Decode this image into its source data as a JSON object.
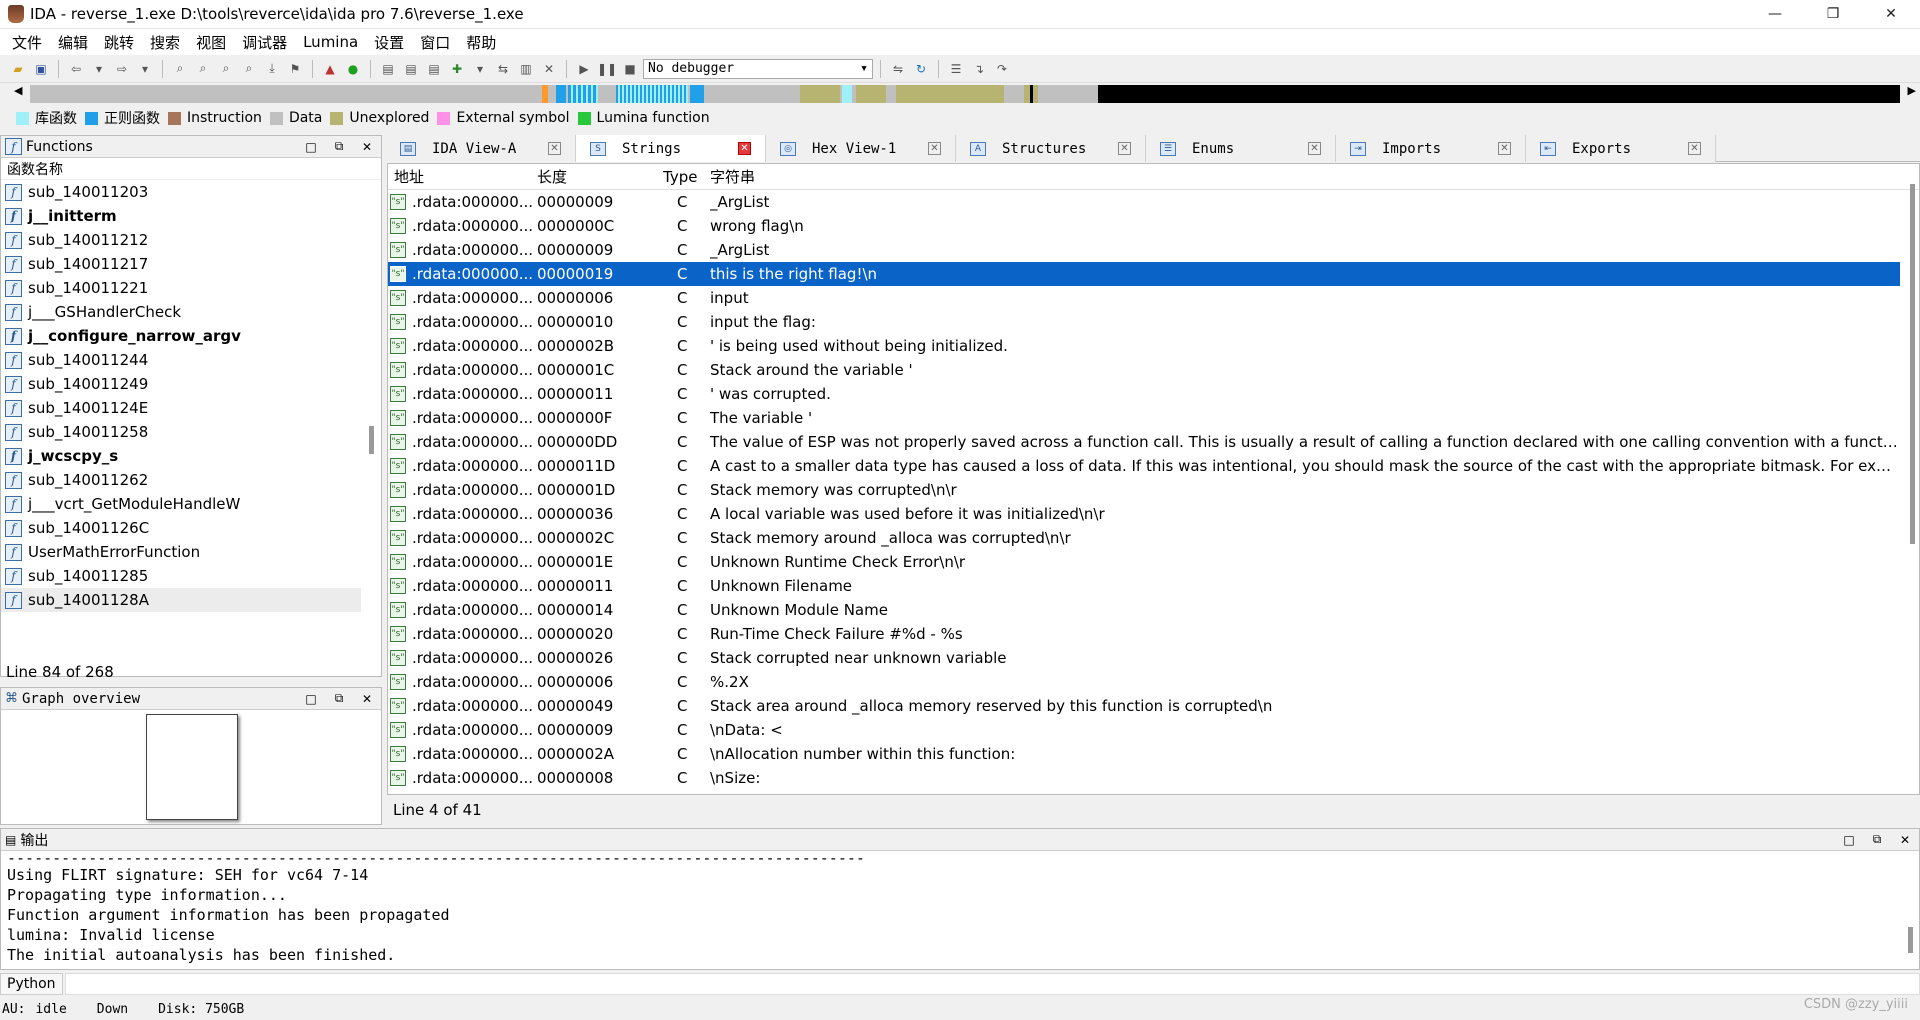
{
  "window": {
    "title": "IDA - reverse_1.exe D:\\tools\\reverce\\ida\\ida pro 7.6\\reverse_1.exe"
  },
  "menu": [
    "文件",
    "编辑",
    "跳转",
    "搜索",
    "视图",
    "调试器",
    "Lumina",
    "设置",
    "窗口",
    "帮助"
  ],
  "toolbar": {
    "debugger": "No debugger"
  },
  "legend": [
    {
      "label": "库函数",
      "color": "#9ff0f8"
    },
    {
      "label": "正则函数",
      "color": "#1fa0e8"
    },
    {
      "label": "Instruction",
      "color": "#a5765c"
    },
    {
      "label": "Data",
      "color": "#c0c0c0"
    },
    {
      "label": "Unexplored",
      "color": "#b7b472"
    },
    {
      "label": "External symbol",
      "color": "#ff90e8"
    },
    {
      "label": "Lumina function",
      "color": "#28c83c"
    }
  ],
  "functions": {
    "title": "Functions",
    "column": "函数名称",
    "items": [
      {
        "name": "sub_140011203",
        "bold": false
      },
      {
        "name": "j__initterm",
        "bold": true
      },
      {
        "name": "sub_140011212",
        "bold": false
      },
      {
        "name": "sub_140011217",
        "bold": false
      },
      {
        "name": "sub_140011221",
        "bold": false
      },
      {
        "name": "j___GSHandlerCheck",
        "bold": false
      },
      {
        "name": "j__configure_narrow_argv",
        "bold": true
      },
      {
        "name": "sub_140011244",
        "bold": false
      },
      {
        "name": "sub_140011249",
        "bold": false
      },
      {
        "name": "sub_14001124E",
        "bold": false
      },
      {
        "name": "sub_140011258",
        "bold": false
      },
      {
        "name": "j_wcscpy_s",
        "bold": true
      },
      {
        "name": "sub_140011262",
        "bold": false
      },
      {
        "name": "j___vcrt_GetModuleHandleW",
        "bold": false
      },
      {
        "name": "sub_14001126C",
        "bold": false
      },
      {
        "name": "UserMathErrorFunction",
        "bold": false
      },
      {
        "name": "sub_140011285",
        "bold": false
      },
      {
        "name": "sub_14001128A",
        "bold": false
      }
    ],
    "status": "Line 84 of 268"
  },
  "graph": {
    "title": "Graph overview"
  },
  "tabs": [
    {
      "label": "IDA View-A",
      "icon": "ida-view-icon"
    },
    {
      "label": "Strings",
      "icon": "strings-icon",
      "active": true
    },
    {
      "label": "Hex View-1",
      "icon": "hex-view-icon"
    },
    {
      "label": "Structures",
      "icon": "structures-icon"
    },
    {
      "label": "Enums",
      "icon": "enums-icon"
    },
    {
      "label": "Imports",
      "icon": "imports-icon"
    },
    {
      "label": "Exports",
      "icon": "exports-icon"
    }
  ],
  "strings": {
    "headers": {
      "addr": "地址",
      "len": "长度",
      "type": "Type",
      "str": "字符串"
    },
    "rows": [
      {
        "addr": ".rdata:000000...",
        "len": "00000009",
        "type": "C",
        "str": "_ArgList"
      },
      {
        "addr": ".rdata:000000...",
        "len": "0000000C",
        "type": "C",
        "str": "wrong flag\\n"
      },
      {
        "addr": ".rdata:000000...",
        "len": "00000009",
        "type": "C",
        "str": "_ArgList"
      },
      {
        "addr": ".rdata:000000...",
        "len": "00000019",
        "type": "C",
        "str": "this is the right flag!\\n",
        "selected": true
      },
      {
        "addr": ".rdata:000000...",
        "len": "00000006",
        "type": "C",
        "str": "input"
      },
      {
        "addr": ".rdata:000000...",
        "len": "00000010",
        "type": "C",
        "str": "input the flag:"
      },
      {
        "addr": ".rdata:000000...",
        "len": "0000002B",
        "type": "C",
        "str": "' is being used without being initialized."
      },
      {
        "addr": ".rdata:000000...",
        "len": "0000001C",
        "type": "C",
        "str": "Stack around the variable '"
      },
      {
        "addr": ".rdata:000000...",
        "len": "00000011",
        "type": "C",
        "str": "' was corrupted."
      },
      {
        "addr": ".rdata:000000...",
        "len": "0000000F",
        "type": "C",
        "str": "The variable '"
      },
      {
        "addr": ".rdata:000000...",
        "len": "000000DD",
        "type": "C",
        "str": "The value of ESP was not properly saved across a function call.  This is usually a result of calling a function declared with one calling convention with a function po..."
      },
      {
        "addr": ".rdata:000000...",
        "len": "0000011D",
        "type": "C",
        "str": "A cast to a smaller data type has caused a loss of data.  If this was intentional, you should mask the source of the cast with the appropriate bitmask.  For example: ..."
      },
      {
        "addr": ".rdata:000000...",
        "len": "0000001D",
        "type": "C",
        "str": "Stack memory was corrupted\\n\\r"
      },
      {
        "addr": ".rdata:000000...",
        "len": "00000036",
        "type": "C",
        "str": "A local variable was used before it was initialized\\n\\r"
      },
      {
        "addr": ".rdata:000000...",
        "len": "0000002C",
        "type": "C",
        "str": "Stack memory around _alloca was corrupted\\n\\r"
      },
      {
        "addr": ".rdata:000000...",
        "len": "0000001E",
        "type": "C",
        "str": "Unknown Runtime Check Error\\n\\r"
      },
      {
        "addr": ".rdata:000000...",
        "len": "00000011",
        "type": "C",
        "str": "Unknown Filename"
      },
      {
        "addr": ".rdata:000000...",
        "len": "00000014",
        "type": "C",
        "str": "Unknown Module Name"
      },
      {
        "addr": ".rdata:000000...",
        "len": "00000020",
        "type": "C",
        "str": "Run-Time Check Failure #%d - %s"
      },
      {
        "addr": ".rdata:000000...",
        "len": "00000026",
        "type": "C",
        "str": "Stack corrupted near unknown variable"
      },
      {
        "addr": ".rdata:000000...",
        "len": "00000006",
        "type": "C",
        "str": "%.2X"
      },
      {
        "addr": ".rdata:000000...",
        "len": "00000049",
        "type": "C",
        "str": "Stack area around _alloca memory reserved by this function is corrupted\\n"
      },
      {
        "addr": ".rdata:000000...",
        "len": "00000009",
        "type": "C",
        "str": "\\nData: <"
      },
      {
        "addr": ".rdata:000000...",
        "len": "0000002A",
        "type": "C",
        "str": "\\nAllocation number within this function:"
      },
      {
        "addr": ".rdata:000000...",
        "len": "00000008",
        "type": "C",
        "str": "\\nSize:"
      }
    ],
    "status": "Line 4 of 41"
  },
  "output": {
    "title": "输出",
    "lines": [
      "-----------------------------------------------------------------------------------------------",
      "Using FLIRT signature: SEH for vc64 7-14",
      "Propagating type information...",
      "Function argument information has been propagated",
      "lumina: Invalid license",
      "The initial autoanalysis has been finished."
    ]
  },
  "python": {
    "label": "Python"
  },
  "status": {
    "au": "AU:",
    "state": "idle",
    "dir": "Down",
    "disk": "Disk: 750GB"
  },
  "watermark": "CSDN @zzy_yiiii"
}
